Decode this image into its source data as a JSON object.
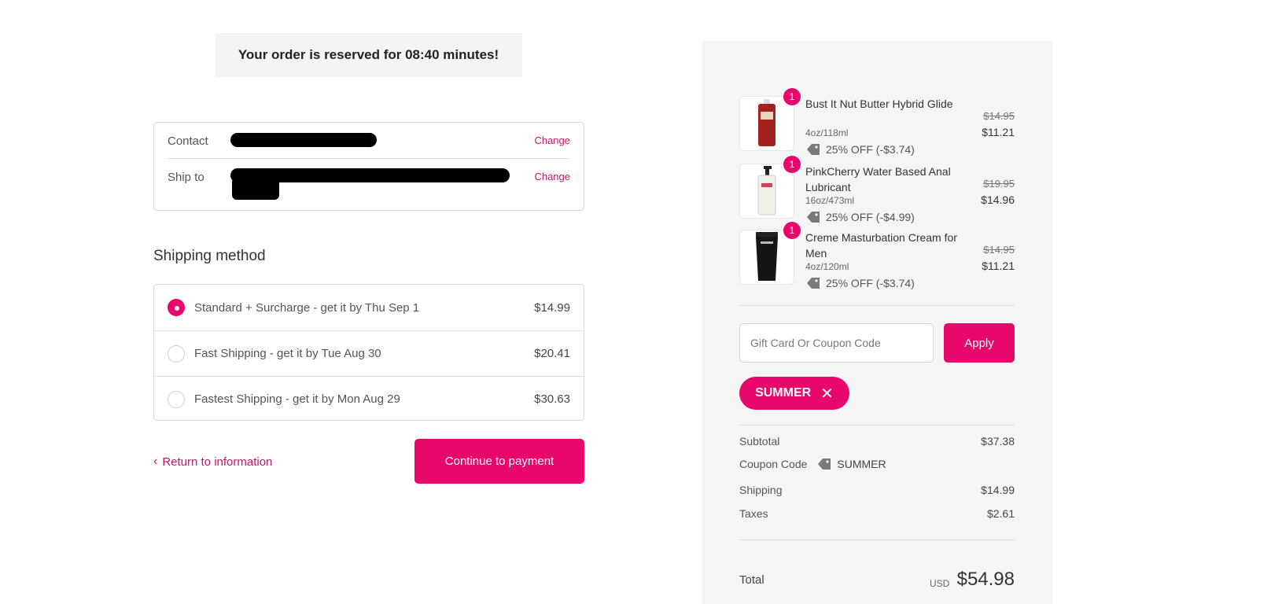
{
  "banner": {
    "text": "Your order is reserved for 08:40 minutes!"
  },
  "info": {
    "contact_label": "Contact",
    "ship_to_label": "Ship to",
    "change_label": "Change"
  },
  "shipping": {
    "heading": "Shipping method",
    "options": [
      {
        "label": "Standard + Surcharge - get it by Thu Sep 1",
        "price": "$14.99",
        "selected": true
      },
      {
        "label": "Fast Shipping - get it by Tue Aug 30",
        "price": "$20.41",
        "selected": false
      },
      {
        "label": "Fastest Shipping - get it by Mon Aug 29",
        "price": "$30.63",
        "selected": false
      }
    ]
  },
  "nav": {
    "return_label": "Return to information",
    "continue_label": "Continue to payment"
  },
  "summary": {
    "items": [
      {
        "qty": "1",
        "name": "Bust It Nut Butter Hybrid Glide",
        "size": "4oz/118ml",
        "discount": "25% OFF (-$3.74)",
        "old_price": "$14.95",
        "price": "$11.21"
      },
      {
        "qty": "1",
        "name": "PinkCherry Water Based Anal Lubricant",
        "size": "16oz/473ml",
        "discount": "25% OFF (-$4.99)",
        "old_price": "$19.95",
        "price": "$14.96"
      },
      {
        "qty": "1",
        "name": "Creme Masturbation Cream for Men",
        "size": "4oz/120ml",
        "discount": "25% OFF (-$3.74)",
        "old_price": "$14.95",
        "price": "$11.21"
      }
    ],
    "coupon_placeholder": "Gift Card Or Coupon Code",
    "apply_label": "Apply",
    "applied_code": "SUMMER",
    "subtotal_label": "Subtotal",
    "subtotal": "$37.38",
    "coupon_label": "Coupon Code",
    "coupon_code": "SUMMER",
    "shipping_label": "Shipping",
    "shipping": "$14.99",
    "taxes_label": "Taxes",
    "taxes": "$2.61",
    "total_label": "Total",
    "currency": "USD",
    "total": "$54.98"
  },
  "colors": {
    "accent": "#e8086c",
    "link": "#c8156a",
    "panel": "#f5f5f5"
  }
}
